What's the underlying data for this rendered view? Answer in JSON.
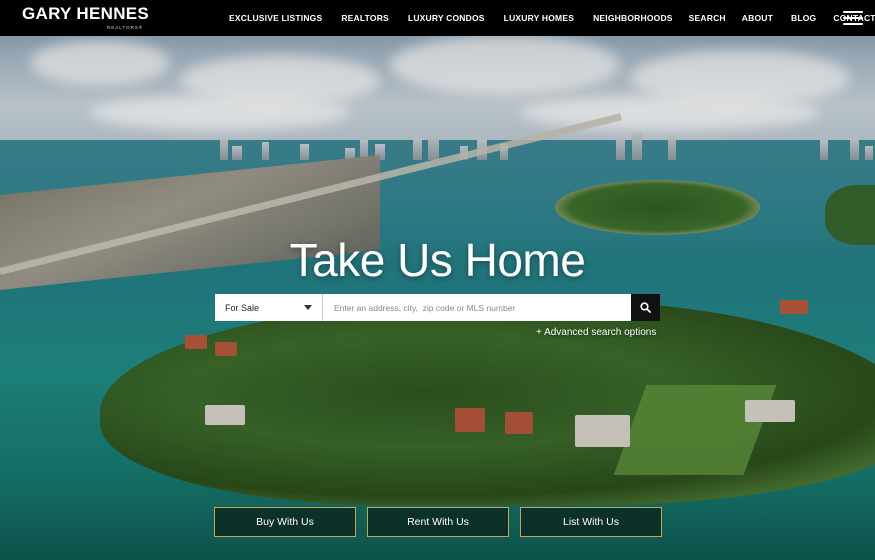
{
  "brand": {
    "name": "GARY HENNES",
    "sub": "REALTORS®"
  },
  "nav": {
    "items": [
      "EXCLUSIVE LISTINGS",
      "REALTORS",
      "LUXURY CONDOS",
      "LUXURY HOMES",
      "NEIGHBORHOODS",
      "SEARCH",
      "ABOUT",
      "BLOG",
      "CONTACT"
    ],
    "menu_icon": "hamburger-icon"
  },
  "hero": {
    "headline": "Take Us Home",
    "search": {
      "type_selected": "For Sale",
      "placeholder": "Enter an address, city,  zip code or MLS number",
      "button_icon": "search-icon"
    },
    "advanced_link": "+ Advanced search options",
    "ctas": [
      "Buy With Us",
      "Rent With Us",
      "List With Us"
    ]
  },
  "colors": {
    "header_bg": "#000000",
    "cta_border": "#c9a64e",
    "cta_bg": "#0c2d26"
  }
}
